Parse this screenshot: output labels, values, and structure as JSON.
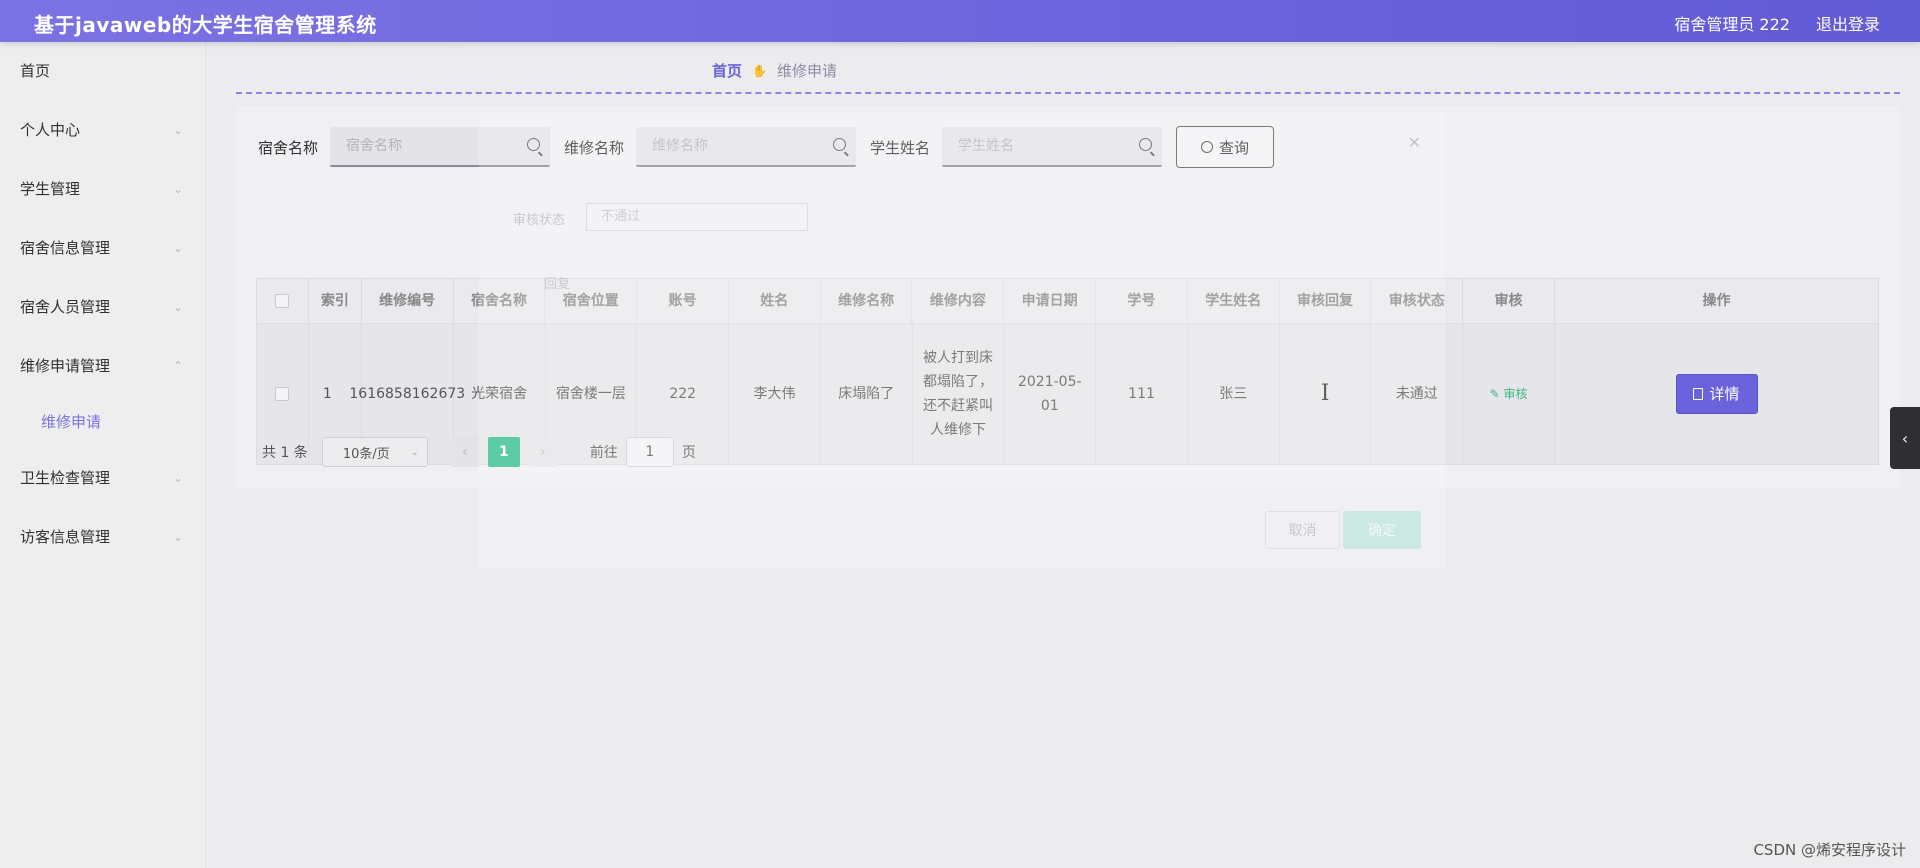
{
  "header": {
    "title": "基于javaweb的大学生宿舍管理系统",
    "user": "宿舍管理员 222",
    "logout": "退出登录"
  },
  "sidebar": {
    "items": [
      {
        "label": "首页"
      },
      {
        "label": "个人中心"
      },
      {
        "label": "学生管理"
      },
      {
        "label": "宿舍信息管理"
      },
      {
        "label": "宿舍人员管理"
      },
      {
        "label": "维修申请管理"
      },
      {
        "label": "卫生检查管理"
      },
      {
        "label": "访客信息管理"
      }
    ],
    "sub_item": "维修申请"
  },
  "breadcrumb": {
    "home": "首页",
    "current": "维修申请"
  },
  "search": {
    "dorm_label": "宿舍名称",
    "dorm_placeholder": "宿舍名称",
    "repair_label": "维修名称",
    "repair_placeholder": "维修名称",
    "student_label": "学生姓名",
    "student_placeholder": "学生姓名",
    "query_button": "查询"
  },
  "table": {
    "headers": [
      "索引",
      "维修编号",
      "宿舍名称",
      "宿舍位置",
      "账号",
      "姓名",
      "维修名称",
      "维修内容",
      "申请日期",
      "学号",
      "学生姓名",
      "审核回复",
      "审核状态",
      "审核",
      "操作"
    ],
    "row": {
      "index": "1",
      "repair_no": "1616858162673",
      "dorm_name": "光荣宿舍",
      "dorm_location": "宿舍楼一层",
      "account": "222",
      "name": "李大伟",
      "repair_name": "床塌陷了",
      "repair_content": "被人打到床都塌陷了，还不赶紧叫人维修下",
      "apply_date": "2021-05-01",
      "student_no": "111",
      "student_name": "张三",
      "audit_reply": "",
      "audit_status": "未通过",
      "audit_action": "审核",
      "detail_button": "详情"
    }
  },
  "pagination": {
    "total": "共 1 条",
    "page_size": "10条/页",
    "current_page": "1",
    "goto_label": "前往",
    "goto_value": "1",
    "page_unit": "页"
  },
  "dialog_ghost": {
    "status_label": "审核状态",
    "status_value": "不通过",
    "reply_label": "回复",
    "cancel": "取消",
    "confirm": "确定"
  },
  "watermark": "CSDN @烯安程序设计",
  "colors": {
    "primary": "#6b63dc",
    "success": "#2fbd8e"
  }
}
